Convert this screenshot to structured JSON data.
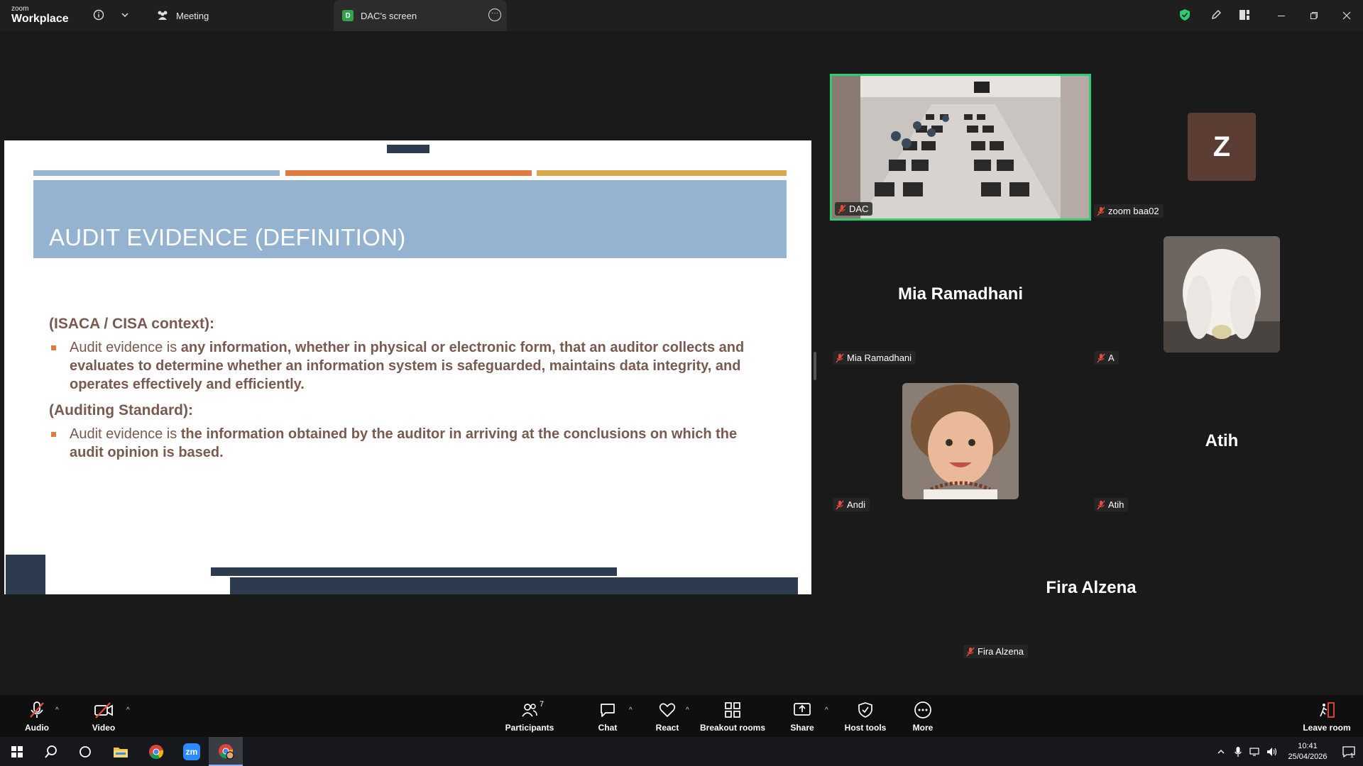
{
  "titlebar": {
    "brand_small": "zoom",
    "brand_big": "Workplace",
    "tab_meeting": "Meeting",
    "tab_screen": "DAC's screen",
    "tab_screen_badge": "D"
  },
  "slide": {
    "title": "AUDIT EVIDENCE (DEFINITION)",
    "heading1": "(ISACA / CISA context):",
    "bullet1_lead": "Audit evidence is ",
    "bullet1_bold": "any information, whether in physical or electronic form, that an auditor collects and evaluates to determine whether an information system is safeguarded, maintains data integrity, and operates effectively and efficiently.",
    "heading2": "(Auditing Standard):",
    "bullet2_lead": "Audit evidence is ",
    "bullet2_bold": "the information obtained by the auditor in arriving at the conclusions on which the audit opinion is based.",
    "colors": {
      "bar1": "#98b4d0",
      "bar2": "#e07b3f",
      "bar3": "#d8a94c",
      "title_bg": "#94b3d0",
      "text": "#7a5a50",
      "dark": "#2d3b4f"
    }
  },
  "participants": [
    {
      "label": "DAC",
      "big_name": "",
      "video": true
    },
    {
      "label": "zoom baa02",
      "big_name": "",
      "initial": "Z"
    },
    {
      "label": "Mia Ramadhani",
      "big_name": "Mia Ramadhani"
    },
    {
      "label": "A",
      "big_name": ""
    },
    {
      "label": "Andi",
      "big_name": ""
    },
    {
      "label": "Atih",
      "big_name": "Atih"
    },
    {
      "label": "Fira Alzena",
      "big_name": "Fira Alzena"
    }
  ],
  "toolbar": {
    "audio": "Audio",
    "video": "Video",
    "participants": "Participants",
    "participants_count": "7",
    "chat": "Chat",
    "react": "React",
    "breakout": "Breakout rooms",
    "share": "Share",
    "host_tools": "Host tools",
    "more": "More",
    "leave": "Leave room"
  },
  "taskbar": {
    "time": "10:41",
    "date": "25/04/2026",
    "notification_count": "1",
    "zoom_app_label": "zm"
  }
}
